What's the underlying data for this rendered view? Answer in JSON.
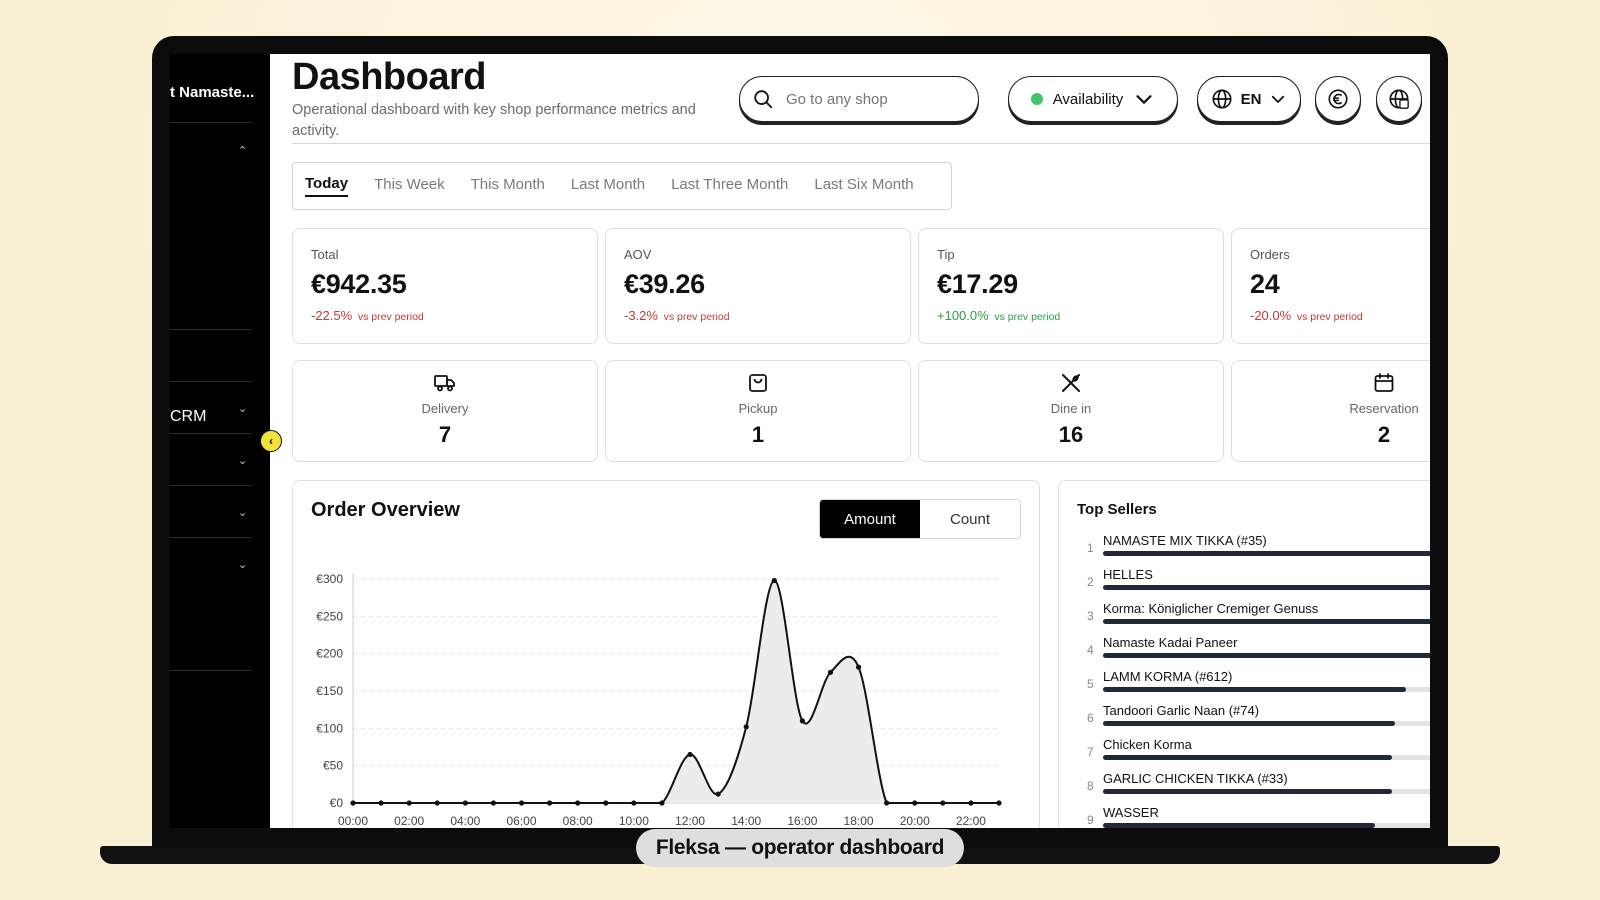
{
  "sidebar": {
    "shop_name": "t Namaste...",
    "crm_label": "CRM"
  },
  "header": {
    "title": "Dashboard",
    "subtitle": "Operational dashboard with key shop performance metrics and activity.",
    "search_placeholder": "Go to any shop",
    "availability_label": "Availability",
    "language_label": "EN"
  },
  "tabs": [
    {
      "label": "Today",
      "active": true
    },
    {
      "label": "This Week",
      "active": false
    },
    {
      "label": "This Month",
      "active": false
    },
    {
      "label": "Last Month",
      "active": false
    },
    {
      "label": "Last Three Month",
      "active": false
    },
    {
      "label": "Last Six Month",
      "active": false
    }
  ],
  "stats": [
    {
      "label": "Total",
      "value": "€942.35",
      "change": "-22.5%",
      "note": "vs prev period",
      "trend": "neg"
    },
    {
      "label": "AOV",
      "value": "€39.26",
      "change": "-3.2%",
      "note": "vs prev period",
      "trend": "neg"
    },
    {
      "label": "Tip",
      "value": "€17.29",
      "change": "+100.0%",
      "note": "vs prev period",
      "trend": "pos"
    },
    {
      "label": "Orders",
      "value": "24",
      "change": "-20.0%",
      "note": "vs prev period",
      "trend": "neg"
    }
  ],
  "order_types": [
    {
      "label": "Delivery",
      "value": "7",
      "icon": "truck-icon"
    },
    {
      "label": "Pickup",
      "value": "1",
      "icon": "bag-icon"
    },
    {
      "label": "Dine in",
      "value": "16",
      "icon": "utensils-icon"
    },
    {
      "label": "Reservation",
      "value": "2",
      "icon": "calendar-icon"
    }
  ],
  "order_overview": {
    "title": "Order Overview",
    "toggle": {
      "amount_label": "Amount",
      "count_label": "Count",
      "selected": "Amount"
    }
  },
  "chart_data": {
    "type": "area",
    "title": "Order Overview",
    "xlabel": "",
    "ylabel": "",
    "x": [
      "00:00",
      "01:00",
      "02:00",
      "03:00",
      "04:00",
      "05:00",
      "06:00",
      "07:00",
      "08:00",
      "09:00",
      "10:00",
      "11:00",
      "12:00",
      "13:00",
      "14:00",
      "15:00",
      "16:00",
      "17:00",
      "18:00",
      "19:00",
      "20:00",
      "21:00",
      "22:00",
      "23:00"
    ],
    "x_tick_labels": [
      "00:00",
      "02:00",
      "04:00",
      "06:00",
      "08:00",
      "10:00",
      "12:00",
      "14:00",
      "16:00",
      "18:00",
      "20:00",
      "22:00"
    ],
    "values": [
      0,
      0,
      0,
      0,
      0,
      0,
      0,
      0,
      0,
      0,
      0,
      0,
      65,
      12,
      102,
      298,
      110,
      175,
      182,
      0,
      0,
      0,
      0,
      0
    ],
    "y_tick_labels": [
      "€0",
      "€50",
      "€100",
      "€150",
      "€200",
      "€250",
      "€300"
    ],
    "ylim": [
      0,
      300
    ],
    "grid": true,
    "colors": {
      "line": "#111111",
      "fill": "#ececec"
    }
  },
  "top_sellers": {
    "title": "Top Sellers",
    "items": [
      {
        "rank": "1",
        "name": "NAMASTE MIX TIKKA (#35)",
        "share": 1.0
      },
      {
        "rank": "2",
        "name": "HELLES",
        "share": 1.0
      },
      {
        "rank": "3",
        "name": "Korma: Königlicher Cremiger Genuss",
        "share": 1.0
      },
      {
        "rank": "4",
        "name": "Namaste Kadai Paneer",
        "share": 1.0
      },
      {
        "rank": "5",
        "name": "LAMM KORMA (#612)",
        "share": 0.89
      },
      {
        "rank": "6",
        "name": "Tandoori Garlic Naan (#74)",
        "share": 0.86
      },
      {
        "rank": "7",
        "name": "Chicken Korma",
        "share": 0.85
      },
      {
        "rank": "8",
        "name": "GARLIC CHICKEN TIKKA (#33)",
        "share": 0.85
      },
      {
        "rank": "9",
        "name": "WASSER",
        "share": 0.8
      }
    ]
  },
  "caption": "Fleksa — operator dashboard"
}
